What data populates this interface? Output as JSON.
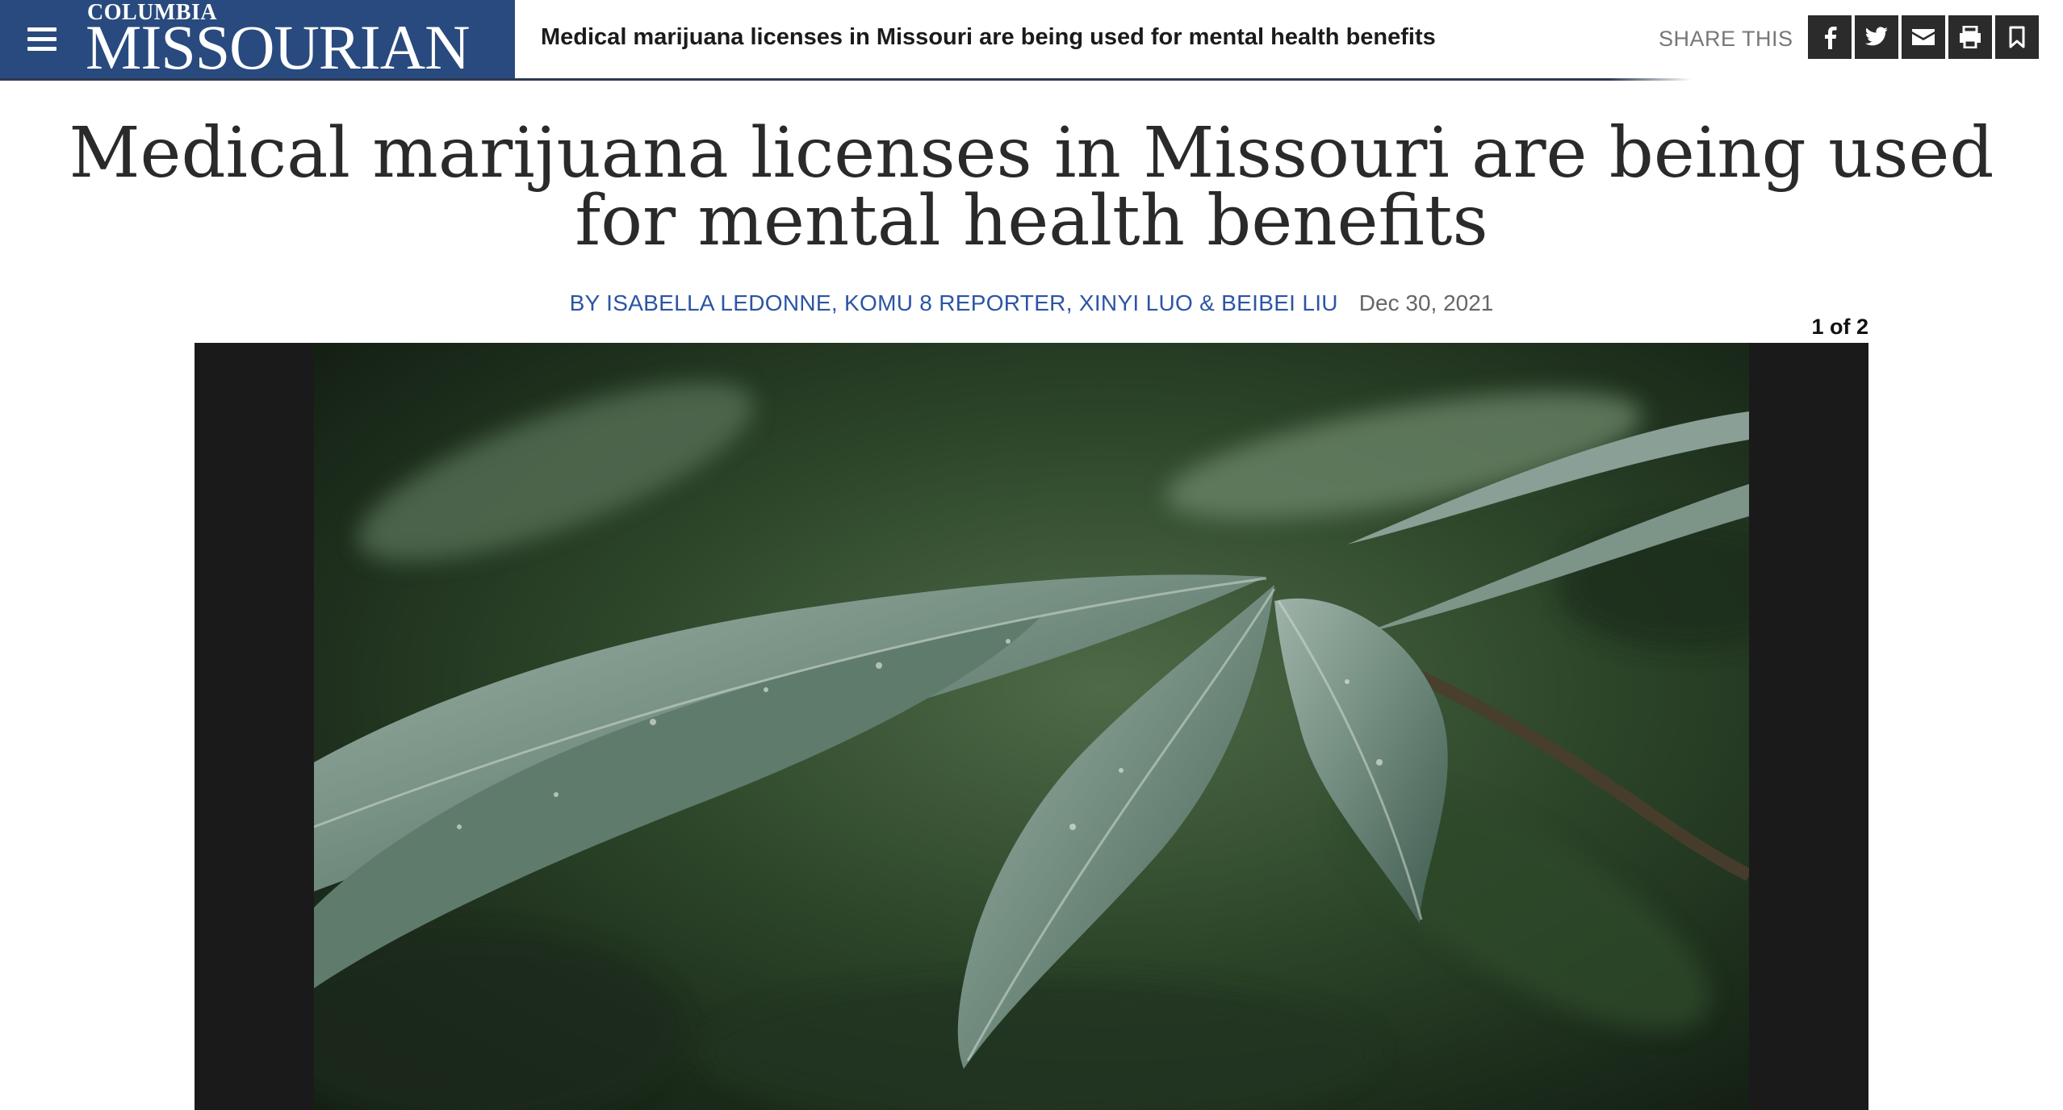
{
  "header": {
    "logo_small": "COLUMBIA",
    "logo_big": "MISSOURIAN",
    "sticky_headline": "Medical marijuana licenses in Missouri are being used for mental health benefits",
    "share_label": "SHARE THIS",
    "share_buttons": [
      "facebook-icon",
      "twitter-icon",
      "email-icon",
      "print-icon",
      "bookmark-icon"
    ],
    "brand_color": "#294a7e"
  },
  "article": {
    "headline": "Medical marijuana licenses in Missouri are being used for mental health benefits",
    "byline": "BY ISABELLA LEDONNE, KOMU 8 REPORTER, XINYI LUO & BEIBEI LIU",
    "date": "Dec 30, 2021"
  },
  "gallery": {
    "counter": "1 of 2",
    "prev_icon": "chevron-left-icon",
    "next_icon": "chevron-right-icon"
  }
}
